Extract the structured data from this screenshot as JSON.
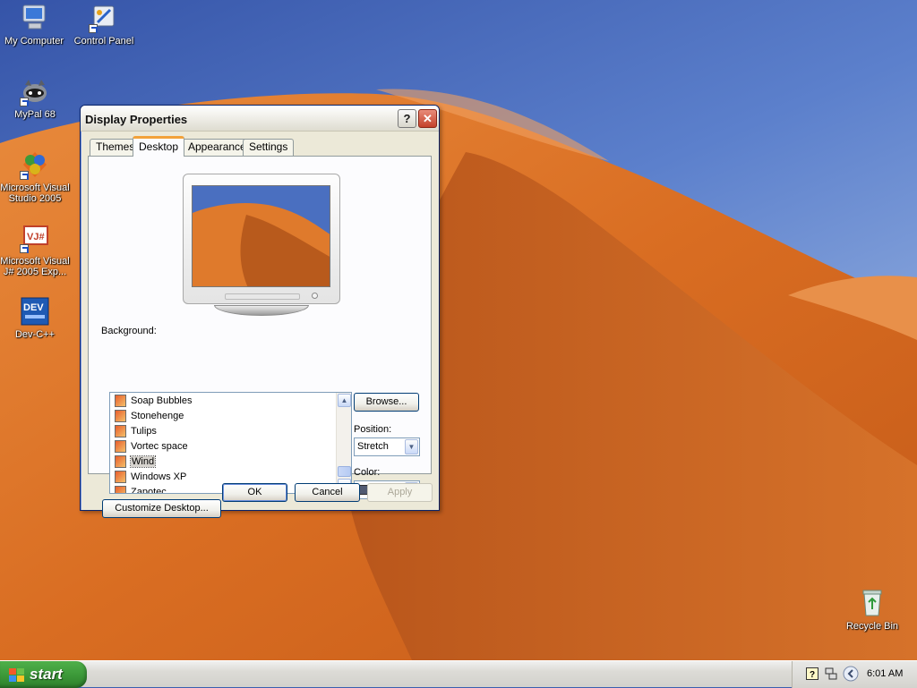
{
  "desktop": {
    "icons": [
      {
        "label": "My Computer",
        "icon": "my-computer-icon"
      },
      {
        "label": "Control Panel",
        "icon": "control-panel-icon"
      },
      {
        "label": "MyPal 68",
        "icon": "mypal-icon"
      },
      {
        "label": "Microsoft Visual Studio 2005",
        "icon": "visual-studio-icon"
      },
      {
        "label": "Microsoft Visual J# 2005 Exp...",
        "icon": "visual-jsharp-icon"
      },
      {
        "label": "Dev-C++",
        "icon": "dev-cpp-icon"
      },
      {
        "label": "Recycle Bin",
        "icon": "recycle-bin-icon"
      }
    ]
  },
  "window": {
    "title": "Display Properties",
    "help_glyph": "?",
    "close_glyph": "✕",
    "tabs": [
      {
        "label": "Themes",
        "active": false
      },
      {
        "label": "Desktop",
        "active": true
      },
      {
        "label": "Appearance",
        "active": false
      },
      {
        "label": "Settings",
        "active": false
      }
    ],
    "background_label": "Background:",
    "background_items": [
      {
        "label": "Soap Bubbles",
        "selected": false
      },
      {
        "label": "Stonehenge",
        "selected": false
      },
      {
        "label": "Tulips",
        "selected": false
      },
      {
        "label": "Vortec space",
        "selected": false
      },
      {
        "label": "Wind",
        "selected": true
      },
      {
        "label": "Windows XP",
        "selected": false
      },
      {
        "label": "Zapotec",
        "selected": false
      }
    ],
    "browse_label": "Browse...",
    "position_label": "Position:",
    "position_value": "Stretch",
    "color_label": "Color:",
    "color_value": "#515a71",
    "customize_label": "Customize Desktop...",
    "ok_label": "OK",
    "cancel_label": "Cancel",
    "apply_label": "Apply"
  },
  "taskbar": {
    "start_label": "start",
    "clock": "6:01 AM"
  },
  "colors": {
    "sky": "#3e64b8",
    "dune": "#e0782a",
    "title_text": "#111111",
    "start_green": "#3d9a3a"
  }
}
